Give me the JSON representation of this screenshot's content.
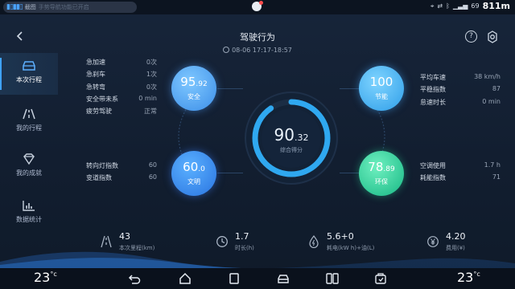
{
  "status_bar": {
    "notification_label": "截图",
    "notification_hint": "手势导航功能已开启",
    "battery": "69",
    "time": "811m"
  },
  "header": {
    "title": "驾驶行为",
    "datetime": "08-06 17:17-18:57"
  },
  "sidebar": {
    "items": [
      {
        "label": "本次行程",
        "icon": "car-icon",
        "active": true
      },
      {
        "label": "我的行程",
        "icon": "road-icon",
        "active": false
      },
      {
        "label": "我的成就",
        "icon": "diamond-icon",
        "active": false
      },
      {
        "label": "数据统计",
        "icon": "bar-chart-icon",
        "active": false
      }
    ]
  },
  "left_top_stats": [
    {
      "label": "急加速",
      "value": "0次"
    },
    {
      "label": "急刹车",
      "value": "1次"
    },
    {
      "label": "急转弯",
      "value": "0次"
    },
    {
      "label": "安全带未系",
      "value": "0 min"
    },
    {
      "label": "疲劳驾驶",
      "value": "正常"
    }
  ],
  "left_bottom_stats": [
    {
      "label": "转向灯指数",
      "value": "60"
    },
    {
      "label": "变道指数",
      "value": "60"
    }
  ],
  "right_top_stats": [
    {
      "label": "平均车速",
      "value": "38 km/h"
    },
    {
      "label": "平稳指数",
      "value": "87"
    },
    {
      "label": "怠速时长",
      "value": "0 min"
    }
  ],
  "right_bottom_stats": [
    {
      "label": "空调使用",
      "value": "1.7 h"
    },
    {
      "label": "耗能指数",
      "value": "71"
    }
  ],
  "scores": {
    "safety": {
      "int": "95",
      "dec": ".92",
      "name": "安全"
    },
    "civility": {
      "int": "60",
      "dec": ".0",
      "name": "文明"
    },
    "energy": {
      "int": "100",
      "dec": "",
      "name": "节能"
    },
    "eco": {
      "int": "78",
      "dec": ".89",
      "name": "环保"
    }
  },
  "overall": {
    "int": "90",
    "dec": ".32",
    "label": "综合得分",
    "progress": 0.9032,
    "accent": "#2fa8f0"
  },
  "bottom_stats": [
    {
      "value": "43",
      "caption": "本次里程(km)",
      "icon": "road-icon"
    },
    {
      "value": "1.7",
      "caption": "时长(h)",
      "icon": "clock-icon"
    },
    {
      "value": "5.6+0",
      "caption": "耗电(kW h)+油(L)",
      "icon": "energy-icon"
    },
    {
      "value": "4.20",
      "caption": "费用(¥)",
      "icon": "yen-icon"
    }
  ],
  "navbar": {
    "temp_left": "23",
    "temp_right": "23",
    "temp_unit": "°c"
  }
}
